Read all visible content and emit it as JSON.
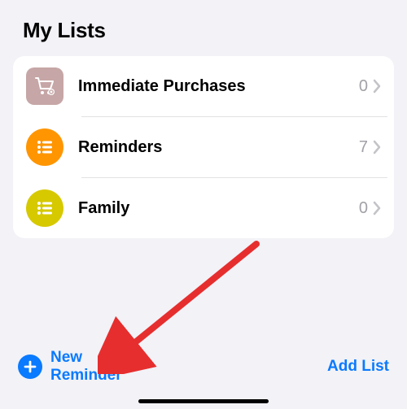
{
  "header": {
    "title": "My Lists"
  },
  "lists": [
    {
      "label": "Immediate Purchases",
      "count": "0",
      "iconColor": "#c6a6a6",
      "iconType": "cart",
      "shape": "square"
    },
    {
      "label": "Reminders",
      "count": "7",
      "iconColor": "#ff9500",
      "iconType": "bullet",
      "shape": "circle"
    },
    {
      "label": "Family",
      "count": "0",
      "iconColor": "#d6c900",
      "iconType": "bullet",
      "shape": "circle"
    }
  ],
  "actions": {
    "newReminder": "New\nReminder",
    "addList": "Add List"
  },
  "annotation": {
    "arrowColor": "#e62e2e"
  }
}
